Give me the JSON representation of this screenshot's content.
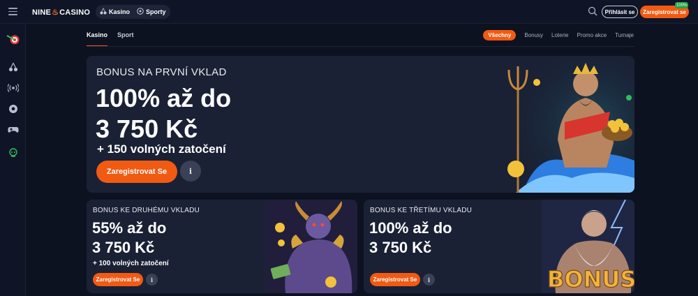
{
  "header": {
    "logo_left": "NINE",
    "logo_right": "CASINO",
    "nav": [
      {
        "label": "Kasino",
        "icon": "cherries-icon"
      },
      {
        "label": "Sporty",
        "icon": "soccer-ball-icon"
      }
    ],
    "login_label": "Přihlásit se",
    "register_label": "Zaregistrovat se",
    "register_badge": "100%"
  },
  "sidebar": {
    "icons": [
      "promo-target-icon",
      "cherries-icon",
      "live-broadcast-icon",
      "soccer-ball-icon",
      "gamepad-icon",
      "support-icon"
    ]
  },
  "tabs": {
    "main": [
      {
        "label": "Kasino",
        "active": true
      },
      {
        "label": "Sport",
        "active": false
      }
    ],
    "filters": [
      {
        "label": "Všechny",
        "active": true
      },
      {
        "label": "Bonusy",
        "active": false
      },
      {
        "label": "Loterie",
        "active": false
      },
      {
        "label": "Promo akce",
        "active": false
      },
      {
        "label": "Turnaje",
        "active": false
      }
    ]
  },
  "banners": {
    "main": {
      "kicker": "BONUS NA PRVNÍ VKLAD",
      "line1": "100% až do",
      "line2": "3 750 Kč",
      "line3": "+ 150 volných zatočení",
      "cta": "Zaregistrovat Se",
      "info": "i"
    },
    "second": {
      "kicker": "BONUS KE DRUHÉMU VKLADU",
      "line1": "55% až do",
      "line2": "3 750 Kč",
      "line3": "+ 100 volných zatočení",
      "cta": "Zaregistrovat Se",
      "info": "i"
    },
    "third": {
      "kicker": "BONUS KE TŘETÍMU VKLADU",
      "line1": "100% až do",
      "line2": "3 750 Kč",
      "cta": "Zaregistrovat Se",
      "info": "i",
      "art_text": "BONUS"
    }
  },
  "colors": {
    "accent": "#f15a13",
    "background": "#0d1220",
    "card": "#1a2135"
  }
}
